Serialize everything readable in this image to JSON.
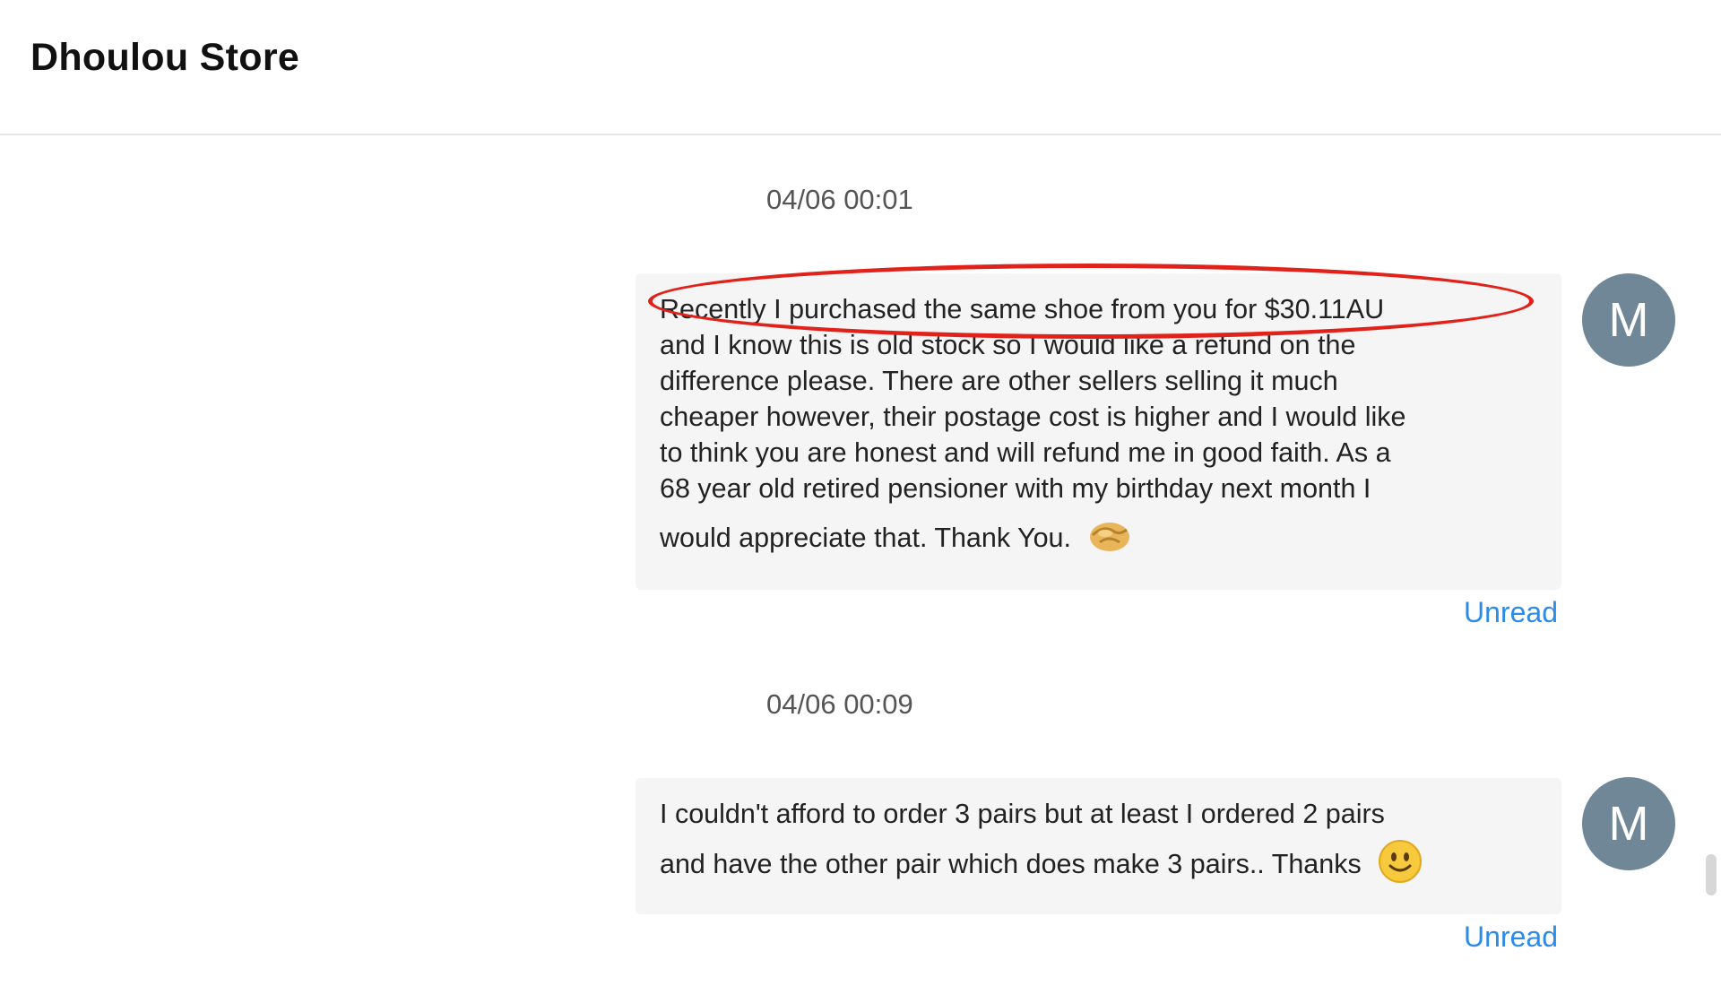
{
  "header": {
    "store_name": "Dhoulou Store"
  },
  "messages": [
    {
      "timestamp": "04/06 00:01",
      "lines": [
        "Recently I purchased the same shoe from you for $30.11AU",
        "and I know this is old stock so I would like a refund on the",
        "difference please. There are other sellers selling it much",
        "cheaper however, their postage cost is higher and I would like",
        "to think you are honest and will refund me in good faith. As a",
        "68 year old retired pensioner with my birthday next month I",
        "would appreciate that. Thank You."
      ],
      "emoji": "handshake-emoji",
      "status": "Unread",
      "avatar_initial": "M"
    },
    {
      "timestamp": "04/06 00:09",
      "lines": [
        "I couldn't afford to order 3 pairs but at least I ordered 2 pairs",
        "and have the other pair which does make 3 pairs.. Thanks"
      ],
      "emoji": "smiley-emoji",
      "status": "Unread",
      "avatar_initial": "M"
    }
  ],
  "annotation": {
    "color": "#e0221b",
    "shape": "ellipse-highlight"
  },
  "colors": {
    "unread": "#2a8be8",
    "avatar_bg": "#6f8796",
    "bubble_bg": "#f5f5f5"
  }
}
